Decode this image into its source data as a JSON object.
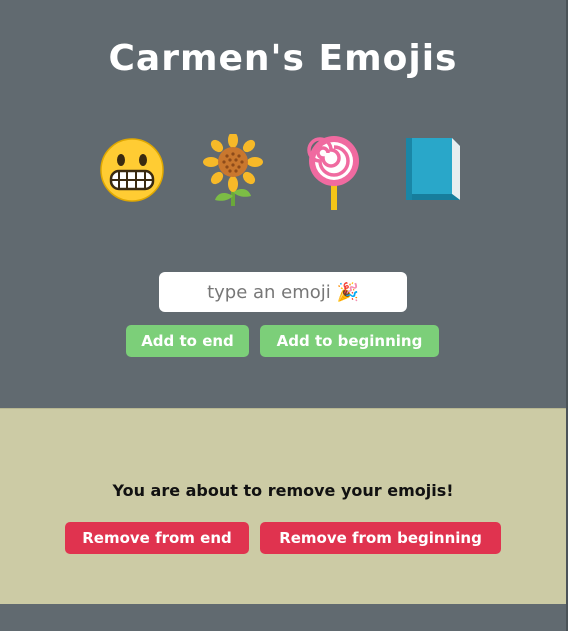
{
  "header": {
    "title": "Carmen's Emojis"
  },
  "emojis": [
    {
      "name": "grimacing-face-icon"
    },
    {
      "name": "sunflower-icon"
    },
    {
      "name": "lollipop-icon"
    },
    {
      "name": "blue-book-icon"
    }
  ],
  "input": {
    "placeholder": "type an emoji 🎉",
    "value": ""
  },
  "add_controls": {
    "add_end_label": "Add to end",
    "add_beginning_label": "Add to beginning"
  },
  "remove_panel": {
    "warning": "You are about to remove your emojis!",
    "remove_end_label": "Remove from end",
    "remove_beginning_label": "Remove from beginning"
  },
  "colors": {
    "background": "#616a70",
    "panel": "#cccba5",
    "add_button": "#7ccf79",
    "remove_button": "#e0334f"
  }
}
